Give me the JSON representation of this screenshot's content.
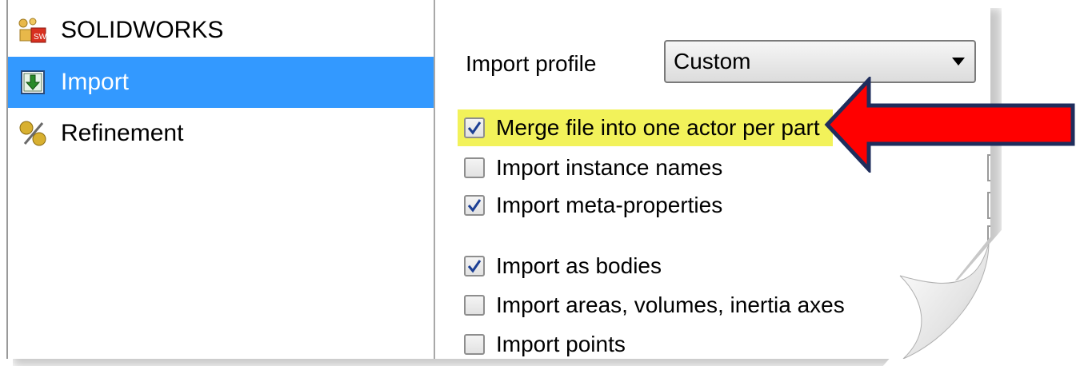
{
  "nav": {
    "items": [
      {
        "label": "SOLIDWORKS",
        "icon": "solidworks-icon",
        "selected": false
      },
      {
        "label": "Import",
        "icon": "import-icon",
        "selected": true
      },
      {
        "label": "Refinement",
        "icon": "refinement-icon",
        "selected": false
      }
    ]
  },
  "panel": {
    "import_profile_label": "Import profile",
    "import_profile_value": "Custom",
    "options": [
      {
        "label": "Merge file into one actor per part",
        "checked": true,
        "highlighted": true
      },
      {
        "label": "Import instance names",
        "checked": false,
        "highlighted": false
      },
      {
        "label": "Import meta-properties",
        "checked": true,
        "highlighted": false
      },
      {
        "label": "Import as bodies",
        "checked": true,
        "highlighted": false
      },
      {
        "label": "Import areas, volumes, inertia axes",
        "checked": false,
        "highlighted": false
      },
      {
        "label": "Import points",
        "checked": false,
        "highlighted": false
      }
    ]
  },
  "colors": {
    "selection": "#3399ff",
    "highlight": "#f2f25a",
    "callout_arrow": "#ff0000",
    "callout_outline": "#1f2d5c",
    "check": "#1c3f94"
  }
}
